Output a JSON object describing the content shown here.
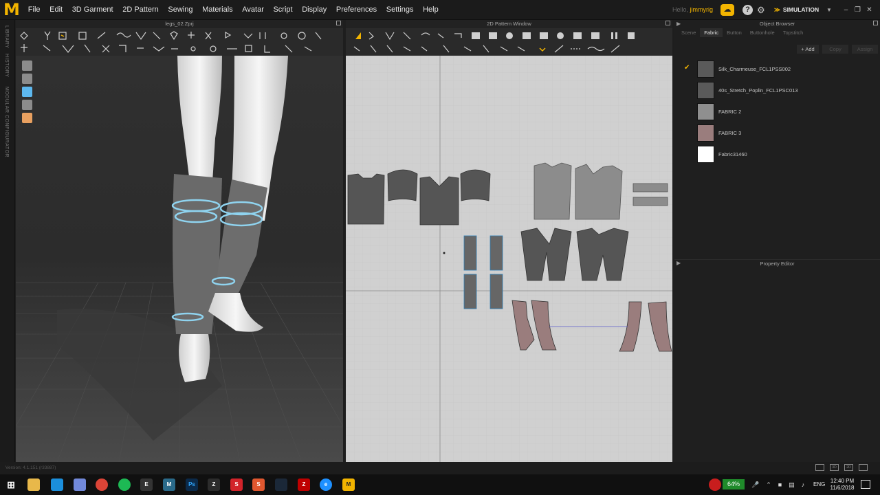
{
  "app": {
    "logo": "M",
    "menu": [
      "File",
      "Edit",
      "3D Garment",
      "2D Pattern",
      "Sewing",
      "Materials",
      "Avatar",
      "Script",
      "Display",
      "Preferences",
      "Settings",
      "Help"
    ],
    "hello_label": "Hello",
    "username": "jimmyrig",
    "mode": "SIMULATION",
    "window_controls": [
      "–",
      "❐",
      "✕"
    ]
  },
  "side_tabs": [
    "LIBRARY",
    "HISTORY",
    "MODULAR CONFIGURATOR"
  ],
  "window3d": {
    "title": "legs_02.Zprj"
  },
  "window2d": {
    "title": "2D Pattern Window"
  },
  "object_browser": {
    "title": "Object Browser",
    "tabs": [
      "Scene",
      "Fabric",
      "Button",
      "Buttonhole",
      "Topstitch"
    ],
    "active_tab": "Fabric",
    "actions": {
      "add": "+ Add",
      "copy": "Copy",
      "assign": "Assign"
    },
    "fabrics": [
      {
        "name": "Silk_Charmeuse_FCL1PSS002",
        "color": "#5a5a5a",
        "selected": true
      },
      {
        "name": "40s_Stretch_Poplin_FCL1PSC013",
        "color": "#5a5a5a",
        "selected": false
      },
      {
        "name": "FABRIC 2",
        "color": "#8f8f8f",
        "selected": false
      },
      {
        "name": "FABRIC 3",
        "color": "#9a7d7d",
        "selected": false
      },
      {
        "name": "Fabric31460",
        "color": "#ffffff",
        "selected": false
      }
    ]
  },
  "property_editor": {
    "title": "Property Editor"
  },
  "status": {
    "version": "Version: 4.1.151 (r33887)"
  },
  "taskbar": {
    "battery": "64%",
    "language": "ENG",
    "time": "12:40 PM",
    "date": "11/6/2018"
  }
}
